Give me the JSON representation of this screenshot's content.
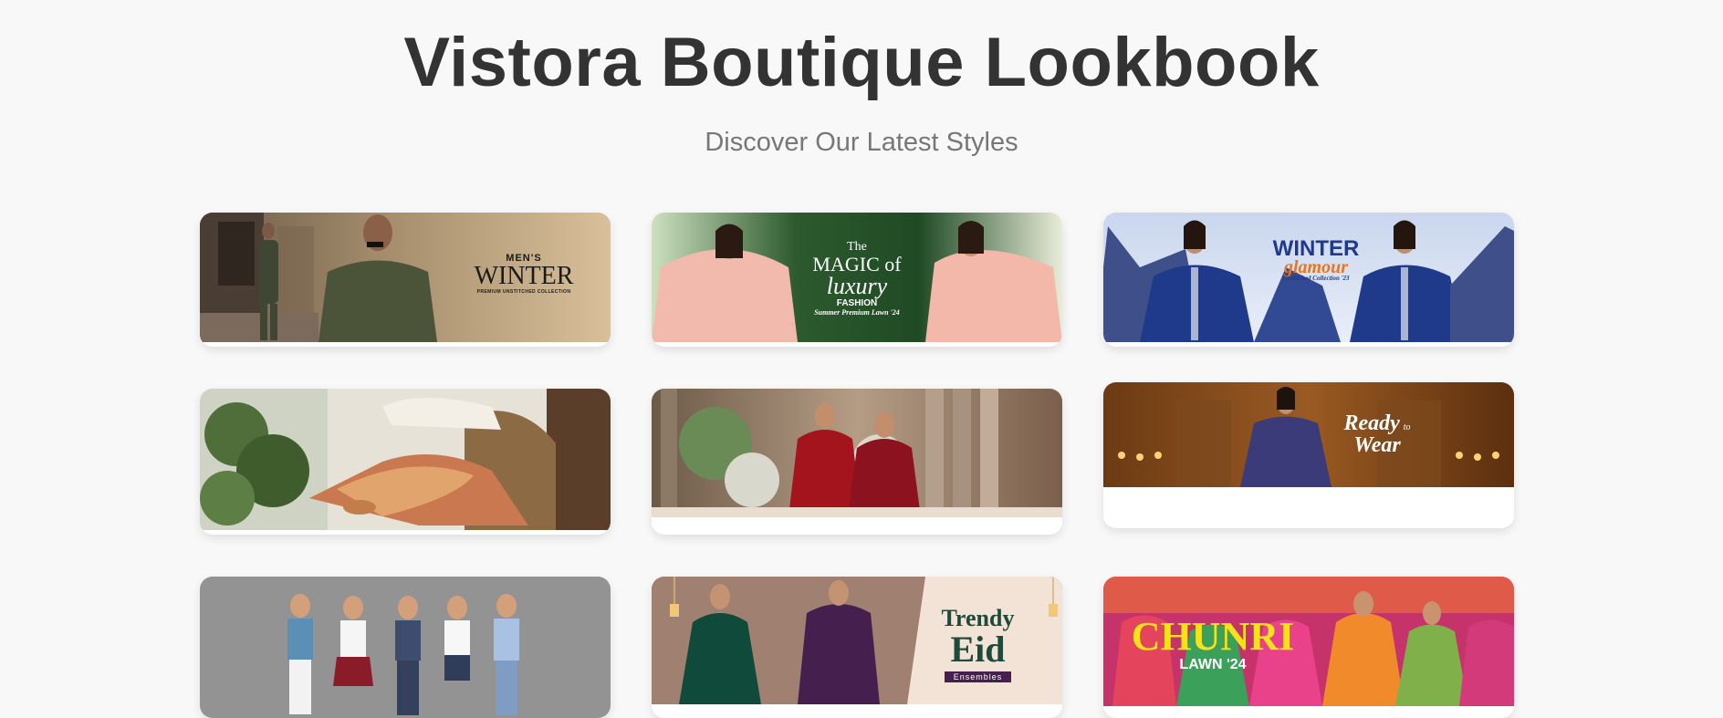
{
  "header": {
    "title": "Vistora Boutique Lookbook",
    "subtitle": "Discover Our Latest Styles"
  },
  "gallery": {
    "cards": [
      {
        "id": "mens-winter",
        "line1": "MEN'S",
        "line2": "WINTER",
        "line3": "PREMIUM UNSTITCHED COLLECTION"
      },
      {
        "id": "magic-luxury",
        "line1": "The",
        "line2": "MAGIC of",
        "line3": "luxury",
        "line4": "FASHION",
        "line5": "Summer Premium Lawn '24"
      },
      {
        "id": "winter-glamour",
        "line1": "WINTER",
        "line2": "glamour",
        "line3": "Unstitched Collection '23"
      },
      {
        "id": "floral-lounge"
      },
      {
        "id": "bridal-red"
      },
      {
        "id": "ready-to-wear",
        "line1": "Ready",
        "line2": "to",
        "line3": "Wear"
      },
      {
        "id": "kids-collection"
      },
      {
        "id": "trendy-eid",
        "line1": "Trendy",
        "line2": "Eid",
        "line3": "Ensembles"
      },
      {
        "id": "chunri-lawn",
        "line1": "CHUNRI",
        "line2": "LAWN '24"
      }
    ]
  },
  "colors": {
    "background": "#f8f8f8",
    "title": "#333333",
    "subtitle": "#777777",
    "card": "#ffffff",
    "winter_blue": "#1f3a8a",
    "glamour_orange": "#e8761c",
    "eid_green": "#1d4a3a",
    "chunri_yellow": "#f6e21a"
  }
}
